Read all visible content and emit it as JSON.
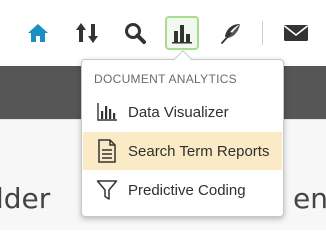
{
  "toolbar": {
    "icons": [
      "home-icon",
      "sort-icon",
      "search-icon",
      "bar-chart-icon",
      "feather-icon",
      "mail-icon"
    ],
    "accent_color": "#1a8fc1",
    "active_border_color": "#a7dc90"
  },
  "background": {
    "left_text": "lder",
    "right_text": "ent"
  },
  "menu": {
    "header": "DOCUMENT ANALYTICS",
    "items": [
      {
        "label": "Data Visualizer",
        "icon": "bar-chart-icon"
      },
      {
        "label": "Search Term Reports",
        "icon": "document-icon",
        "highlighted": true
      },
      {
        "label": "Predictive Coding",
        "icon": "filter-icon"
      }
    ],
    "highlight_color": "#faebc6"
  }
}
